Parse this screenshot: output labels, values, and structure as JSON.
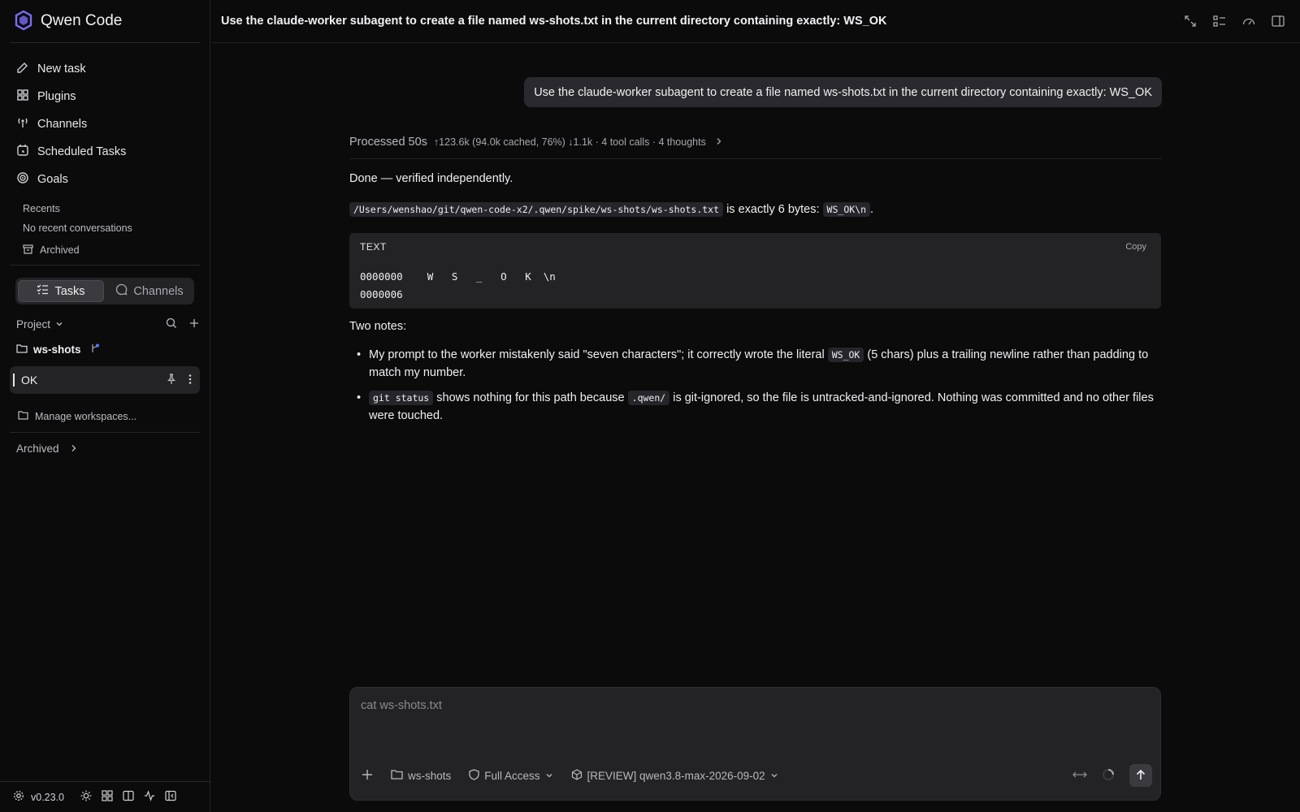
{
  "app": {
    "title": "Qwen Code",
    "version": "v0.23.0"
  },
  "sidebar": {
    "nav": [
      {
        "label": "New task",
        "icon": "edit-icon"
      },
      {
        "label": "Plugins",
        "icon": "plugins-icon"
      },
      {
        "label": "Channels",
        "icon": "broadcast-icon"
      },
      {
        "label": "Scheduled Tasks",
        "icon": "calendar-clock-icon"
      },
      {
        "label": "Goals",
        "icon": "target-icon"
      }
    ],
    "recents_title": "Recents",
    "recents_empty": "No recent conversations",
    "archived_small": "Archived",
    "segments": {
      "tasks": "Tasks",
      "channels": "Channels",
      "active": "Tasks"
    },
    "project_label": "Project",
    "workspace": "ws-shots",
    "active_task": "OK",
    "manage_workspaces": "Manage workspaces...",
    "archived": "Archived"
  },
  "header": {
    "title": "Use the claude-worker subagent to create a file named ws-shots.txt in the current directory containing exactly: WS_OK"
  },
  "chat": {
    "user_message": "Use the claude-worker subagent to create a file named ws-shots.txt in the current directory containing exactly: WS_OK",
    "meta": {
      "processed": "Processed 50s",
      "stats": "↑123.6k (94.0k cached, 76%) ↓1.1k · 4 tool calls · 4 thoughts"
    },
    "response": {
      "line1": "Done — verified independently.",
      "path_code": "/Users/wenshao/git/qwen-code-x2/.qwen/spike/ws-shots/ws-shots.txt",
      "bytes_text": " is exactly 6 bytes: ",
      "bytes_code": "WS_OK\\n",
      "bytes_end": ".",
      "code_lang": "TEXT",
      "copy_label": "Copy",
      "code_line1": "0000000    W   S   _   O   K  \\n",
      "code_line2": "0000006",
      "notes_title": "Two notes:",
      "note1_a": "My prompt to the worker mistakenly said \"seven characters\"; it correctly wrote the literal ",
      "note1_code": "WS_OK",
      "note1_b": " (5 chars) plus a trailing newline rather than padding to match my number.",
      "note2_code1": "git status",
      "note2_a": " shows nothing for this path because ",
      "note2_code2": ".qwen/",
      "note2_b": " is git-ignored, so the file is untracked-and-ignored. Nothing was committed and no other files were touched."
    }
  },
  "composer": {
    "placeholder": "cat ws-shots.txt",
    "workspace": "ws-shots",
    "access": "Full Access",
    "model": "[REVIEW] qwen3.8-max-2026-09-02"
  },
  "colors": {
    "background": "#0b0b0c",
    "panel": "#232326",
    "accent": "#7b6cf6"
  }
}
